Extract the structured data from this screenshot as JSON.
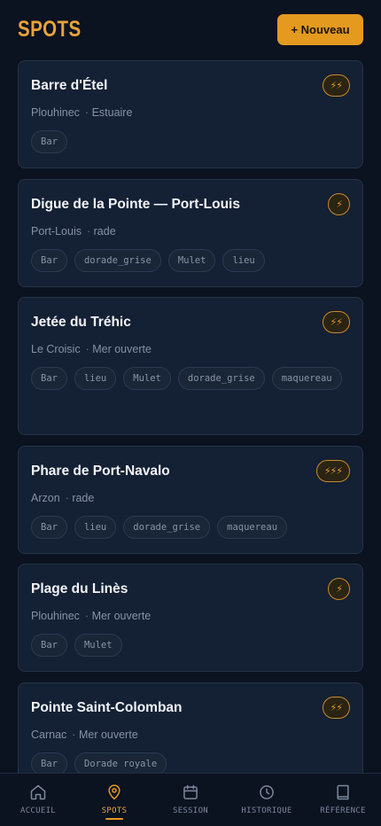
{
  "header": {
    "title": "SPOTS",
    "new_button": "+ Nouveau"
  },
  "spots": [
    {
      "name": "Barre d'Étel",
      "location": "Plouhinec",
      "type": "Estuaire",
      "rating": "⚡⚡",
      "tags": [
        "Bar"
      ]
    },
    {
      "name": "Digue de la Pointe — Port-Louis",
      "location": "Port-Louis",
      "type": "rade",
      "rating": "⚡",
      "tags": [
        "Bar",
        "dorade_grise",
        "Mulet",
        "lieu"
      ]
    },
    {
      "name": "Jetée du Tréhic",
      "location": "Le Croisic",
      "type": "Mer ouverte",
      "rating": "⚡⚡",
      "tags": [
        "Bar",
        "lieu",
        "Mulet",
        "dorade_grise",
        "maquereau"
      ]
    },
    {
      "name": "Phare de Port-Navalo",
      "location": "Arzon",
      "type": "rade",
      "rating": "⚡⚡⚡",
      "tags": [
        "Bar",
        "lieu",
        "dorade_grise",
        "maquereau"
      ]
    },
    {
      "name": "Plage du Linès",
      "location": "Plouhinec",
      "type": "Mer ouverte",
      "rating": "⚡",
      "tags": [
        "Bar",
        "Mulet"
      ]
    },
    {
      "name": "Pointe Saint-Colomban",
      "location": "Carnac",
      "type": "Mer ouverte",
      "rating": "⚡⚡",
      "tags": [
        "Bar",
        "Dorade royale"
      ]
    }
  ],
  "nav": {
    "items": [
      {
        "label": "ACCUEIL",
        "icon": "home-icon"
      },
      {
        "label": "SPOTS",
        "icon": "map-pin-icon"
      },
      {
        "label": "SESSION",
        "icon": "calendar-icon"
      },
      {
        "label": "HISTORIQUE",
        "icon": "clock-icon"
      },
      {
        "label": "RÉFÉRENCE",
        "icon": "book-icon"
      }
    ],
    "active": "SPOTS"
  },
  "colors": {
    "accent": "#e39a1f",
    "background": "#0b1220",
    "card": "#142033"
  }
}
